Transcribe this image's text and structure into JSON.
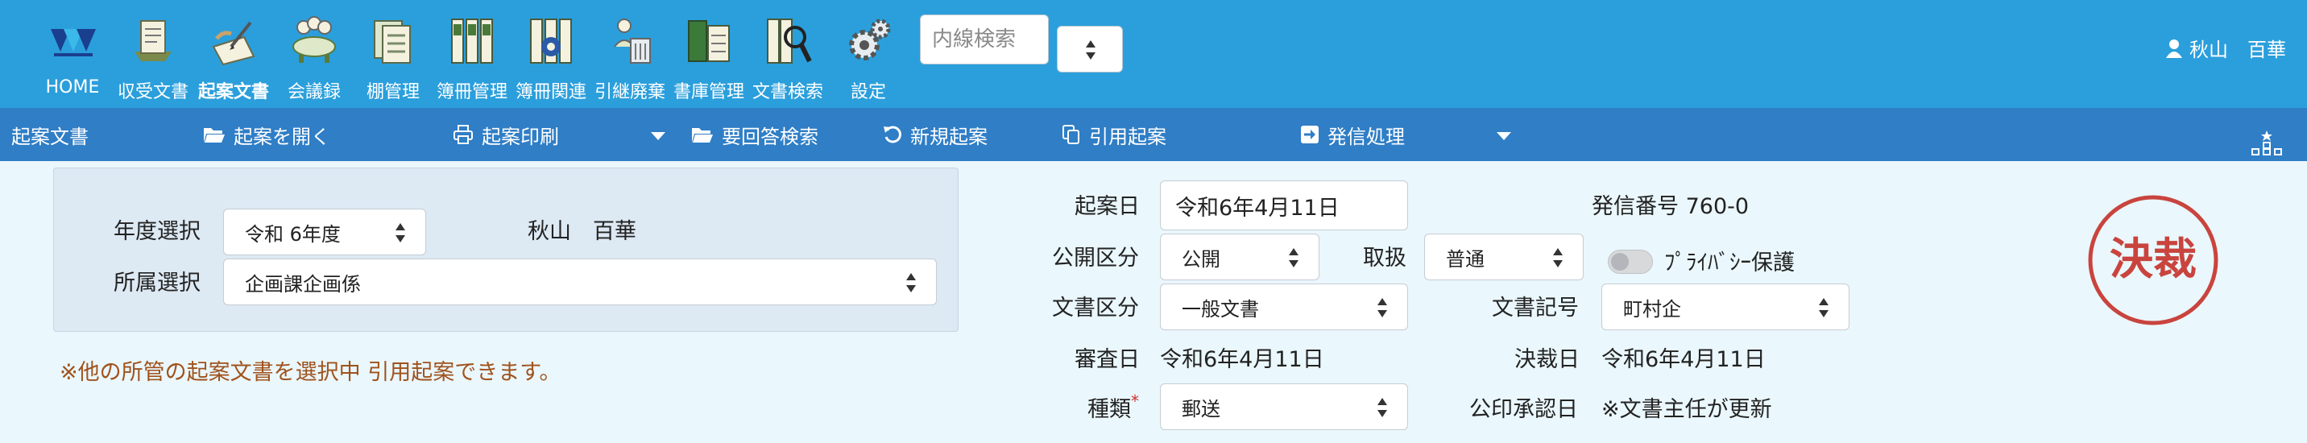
{
  "nav": {
    "items": [
      {
        "label": "HOME",
        "icon": "home-logo-icon"
      },
      {
        "label": "収受文書",
        "icon": "received-documents-icon"
      },
      {
        "label": "起案文書",
        "icon": "draft-document-icon"
      },
      {
        "label": "会議録",
        "icon": "meeting-minutes-icon"
      },
      {
        "label": "棚管理",
        "icon": "shelf-management-icon"
      },
      {
        "label": "簿冊管理",
        "icon": "ledger-binders-icon"
      },
      {
        "label": "簿冊関連",
        "icon": "ledger-related-icon"
      },
      {
        "label": "引継廃棄",
        "icon": "handover-disposal-icon"
      },
      {
        "label": "書庫管理",
        "icon": "archive-management-icon"
      },
      {
        "label": "文書検索",
        "icon": "document-search-icon"
      },
      {
        "label": "設定",
        "icon": "settings-gear-icon"
      }
    ],
    "search_placeholder": "内線検索"
  },
  "user": {
    "name": "秋山　百華",
    "icon": "user-icon"
  },
  "toolbar": {
    "title": "起案文書",
    "open_label": "起案を開く",
    "print_label": "起案印刷",
    "reply_search_label": "要回答検索",
    "new_label": "新規起案",
    "quote_label": "引用起案",
    "send_label": "発信処理"
  },
  "filter": {
    "year_label": "年度選択",
    "year_value": "令和 6年度",
    "owner_name": "秋山　百華",
    "dept_label": "所属選択",
    "dept_value": "企画課企画係"
  },
  "notice": "※他の所管の起案文書を選択中 引用起案できます。",
  "form": {
    "draft_date_label": "起案日",
    "draft_date_value": "令和6年4月11日",
    "sending_number_label": "発信番号",
    "sending_number_value": "760-0",
    "disclosure_label": "公開区分",
    "disclosure_value": "公開",
    "handling_label": "取扱",
    "handling_value": "普通",
    "privacy_label": "ﾌﾟﾗｲﾊﾞｼｰ保護",
    "privacy_on": false,
    "doc_category_label": "文書区分",
    "doc_category_value": "一般文書",
    "doc_symbol_label": "文書記号",
    "doc_symbol_value": "町村企",
    "review_date_label": "審査日",
    "review_date_value": "令和6年4月11日",
    "decision_date_label": "決裁日",
    "decision_date_value": "令和6年4月11日",
    "type_label": "種類",
    "type_required_mark": "*",
    "type_value": "郵送",
    "official_approval_label": "公印承認日",
    "official_approval_value": "※文書主任が更新"
  },
  "stamp": {
    "text": "決裁",
    "color": "#c9443e"
  },
  "colors": {
    "nav_bg": "#2b9fdc",
    "toolbar_bg": "#2f7ec6",
    "page_bg": "#eaf7fc",
    "notice": "#a0521c"
  }
}
